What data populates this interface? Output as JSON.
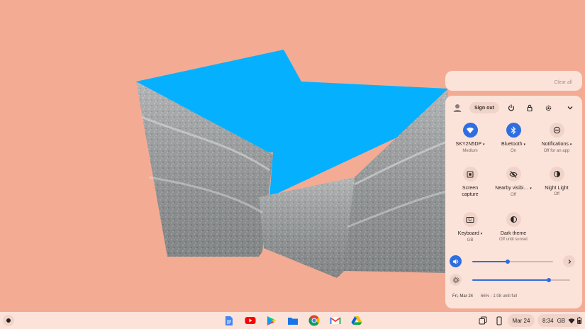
{
  "notifications": {
    "clear_all": "Clear all"
  },
  "quick_settings": {
    "sign_out": "Sign out",
    "header_icons": [
      "power-icon",
      "lock-icon",
      "gear-icon",
      "chevron-down-icon"
    ],
    "tiles": [
      {
        "label": "SKY2N5DP",
        "caret": "▾",
        "sub": "Medium",
        "icon": "wifi-icon",
        "on": true
      },
      {
        "label": "Bluetooth",
        "caret": "▾",
        "sub": "On",
        "icon": "bluetooth-icon",
        "on": true
      },
      {
        "label": "Notifications",
        "caret": "▾",
        "sub": "Off for an app",
        "icon": "do-not-disturb-icon",
        "on": false
      },
      {
        "label": "Screen capture",
        "sub": "",
        "icon": "screen-capture-icon",
        "on": false
      },
      {
        "label": "Nearby visibi…",
        "caret": "▾",
        "sub": "Off",
        "icon": "visibility-off-icon",
        "on": false
      },
      {
        "label": "Night Light",
        "sub": "Off",
        "icon": "night-light-icon",
        "on": false
      },
      {
        "label": "Keyboard",
        "caret": "▾",
        "sub": "GB",
        "icon": "keyboard-icon",
        "on": false
      },
      {
        "label": "Dark theme",
        "sub": "Off until sunset",
        "icon": "dark-theme-icon",
        "on": false
      }
    ],
    "volume_level": 0.44,
    "brightness_level": 0.78,
    "date": "Fri, Mar 24",
    "battery": "66% - 1:08 until full"
  },
  "shelf": {
    "apps": [
      "docs-icon",
      "youtube-icon",
      "play-store-icon",
      "files-icon",
      "chrome-icon",
      "gmail-icon",
      "drive-icon"
    ],
    "date": "Mar 24",
    "time": "8:34",
    "ime": "GB"
  },
  "colors": {
    "accent": "#2f6ee0",
    "wallpaper": "#f4ab94",
    "panel": "#fbe3da",
    "sky": "#05b1ff"
  }
}
